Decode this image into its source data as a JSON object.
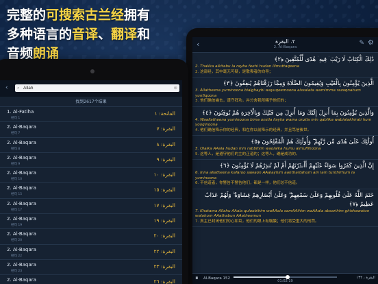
{
  "headline": {
    "line1_a": "完整的",
    "line1_b": "可搜索古兰经",
    "line1_c": "拥有",
    "line2_a": "多种语言的",
    "line2_b": "音译",
    "line2_c": "、",
    "line2_d": "翻译",
    "line2_e": "和",
    "line3_a": "音频",
    "line3_b": "朗诵"
  },
  "colors": {
    "highlight": "#f7d445",
    "translit": "#e8b93c",
    "translation": "#d7a82c"
  },
  "reader": {
    "title": "٢. البقرة",
    "subtitle": "2. Al-Baqara",
    "back_icon": "‹",
    "pen_icon": "✎",
    "gear_icon": "⚙",
    "verses": [
      {
        "arabic": "ذَٰلِكَ الْكِتَابُ لَا رَيْبَ ۛ فِيهِ ۛ هُدًى لِّلْمُتَّقِينَ ﴿٢﴾",
        "translit": "2. Thalika alkitabu la rayba feehi hudan lilmuttaqeena",
        "translation": "2. 这部经，其中毫无可疑，是敬畏者的向导；"
      },
      {
        "arabic": "الَّذِينَ يُؤْمِنُونَ بِالْغَيْبِ وَيُقِيمُونَ الصَّلَاةَ وَمِمَّا رَزَقْنَاهُمْ يُنفِقُونَ ﴿٣﴾",
        "translit": "3. Allatheena yuminoona bialghaybi wayuqeemoona alssalata wamimma razaqnahum yunfiqoona",
        "translation": "3. 他们确信幽玄，谨守拜功，并分舍我所赐予他们的；"
      },
      {
        "arabic": "وَالَّذِينَ يُؤْمِنُونَ بِمَا أُنزِلَ إِلَيْكَ وَمَا أُنزِلَ مِن قَبْلِكَ وَبِالْآخِرَةِ هُمْ يُوقِنُونَ ﴿٤﴾",
        "translit": "4. Waallatheena yuminoona bima onzila ilayka wama onzila min qablika wabialakhirati hum yooqinoona",
        "translation": "4. 他们确信降示你的经典，和在你以前降示的经典，并且笃信後世。"
      },
      {
        "arabic": "أُولَٰئِكَ عَلَىٰ هُدًى مِّن رَّبِّهِمْ ۖ وَأُولَٰئِكَ هُمُ الْمُفْلِحُونَ ﴿٥﴾",
        "translit": "5. Olaika AAala hudan min rabbihim waolaika humu almuflihoona",
        "translation": "5. 这等人，是遵守他们的主的正道的；这等人，确是成功的。"
      },
      {
        "arabic": "إِنَّ الَّذِينَ كَفَرُوا سَوَاءٌ عَلَيْهِمْ أَأَنذَرْتَهُمْ أَمْ لَمْ تُنذِرْهُمْ لَا يُؤْمِنُونَ ﴿٦﴾",
        "translit": "6. Inna allatheena kafaroo sawaon AAalayhim aanthartahum am lam tunthirhum la yuminoona",
        "translation": "6. 不信道者，你警告不警告他们，都是一样，他们总不信道。"
      },
      {
        "arabic": "خَتَمَ اللَّهُ عَلَىٰ قُلُوبِهِمْ وَعَلَىٰ سَمْعِهِمْ ۖ وَعَلَىٰ أَبْصَارِهِمْ غِشَاوَةٌ ۖ وَلَهُمْ عَذَابٌ عَظِيمٌ ﴿٧﴾",
        "translit": "7. Khatama Allahu AAala quloobihim waAAala samAAihim waAAala absarihim ghishawatun walahum AAathabun AAatheemun",
        "translation": "7. 真主已封闭他们的心和耳，他们的眼上有翳膜；他们将受重大的刑罚。"
      }
    ],
    "player": {
      "pause_icon": "⏸",
      "track": "Al-Baqara 152",
      "time": "01:02:19",
      "progress": 0.52,
      "sura_ref": "البقرة ، ١٣٢"
    }
  },
  "search": {
    "back_icon": "‹",
    "search_icon": "⌕",
    "clear_icon": "⊗",
    "query": "Allah",
    "result_count": "找到2617个结果",
    "results": [
      {
        "name": "1. Al-Fatiha",
        "verse": "经句 1",
        "arabic": "الفاتحة: ١"
      },
      {
        "name": "2. Al-Baqara",
        "verse": "经句 7",
        "arabic": "البقرة: ٧"
      },
      {
        "name": "2. Al-Baqara",
        "verse": "经句 8",
        "arabic": "البقرة: ٨"
      },
      {
        "name": "2. Al-Baqara",
        "verse": "经句 9",
        "arabic": "البقرة: ٩"
      },
      {
        "name": "2. Al-Baqara",
        "verse": "经句 10",
        "arabic": "البقرة: ١٠"
      },
      {
        "name": "2. Al-Baqara",
        "verse": "经句 15",
        "arabic": "البقرة: ١٥"
      },
      {
        "name": "2. Al-Baqara",
        "verse": "经句 17",
        "arabic": "البقرة: ١٧"
      },
      {
        "name": "2. Al-Baqara",
        "verse": "经句 19",
        "arabic": "البقرة: ١٩"
      },
      {
        "name": "2. Al-Baqara",
        "verse": "经句 20",
        "arabic": "البقرة: ٢٠"
      },
      {
        "name": "2. Al-Baqara",
        "verse": "经句 22",
        "arabic": "البقرة: ٢٢"
      },
      {
        "name": "2. Al-Baqara",
        "verse": "经句 23",
        "arabic": "البقرة: ٢٣"
      },
      {
        "name": "2. Al-Baqara",
        "verse": "经句 26",
        "arabic": "البقرة: ٢٦"
      }
    ]
  }
}
